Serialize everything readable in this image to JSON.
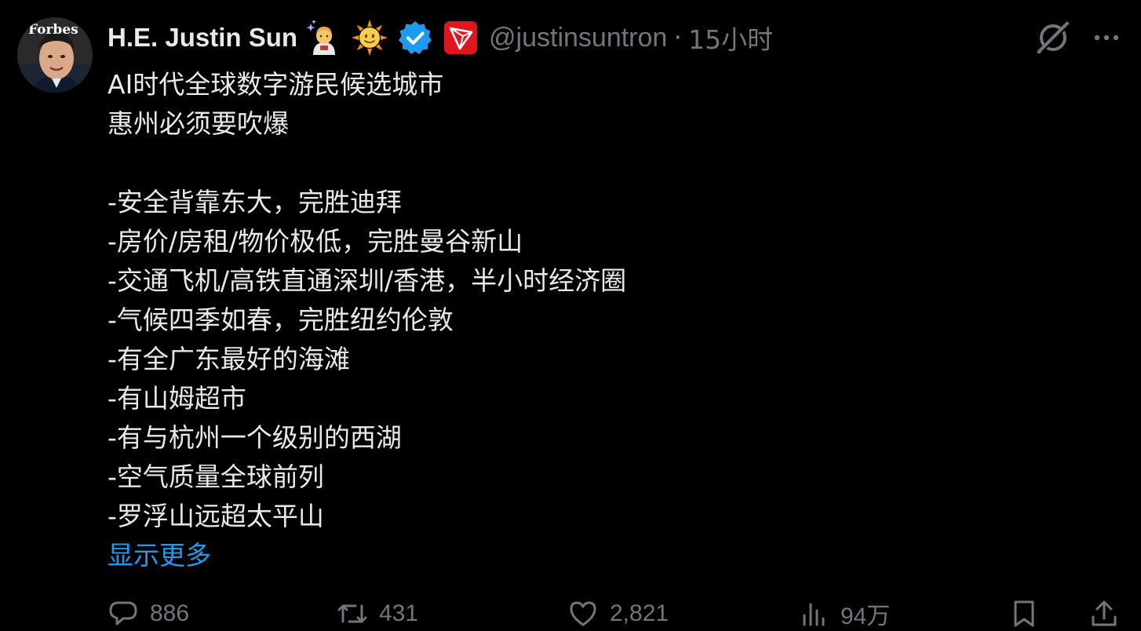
{
  "tweet": {
    "author": {
      "display_name": "H.E. Justin Sun",
      "handle": "@justinsuntron",
      "avatar_caption": "Forbes",
      "badges": [
        "astronaut-emoji",
        "sun-emoji",
        "verified-badge",
        "tron-logo"
      ]
    },
    "separator": "·",
    "time": "15小时",
    "lines": [
      "AI时代全球数字游民候选城市",
      "惠州必须要吹爆",
      "",
      "-安全背靠东大，完胜迪拜",
      "-房价/房租/物价极低，完胜曼谷新山",
      "-交通飞机/高铁直通深圳/香港，半小时经济圈",
      "-气候四季如春，完胜纽约伦敦",
      "-有全广东最好的海滩",
      "-有山姆超市",
      "-有与杭州一个级别的西湖",
      "-空气质量全球前列",
      "-罗浮山远超太平山"
    ],
    "show_more": "显示更多",
    "actions": {
      "replies": "886",
      "reposts": "431",
      "likes": "2,821",
      "views": "94万"
    }
  },
  "colors": {
    "background": "#000000",
    "text": "#e7e9ea",
    "secondary": "#71767b",
    "link": "#1d9bf0",
    "verified": "#1d9bf0",
    "tron": "#e0161f"
  },
  "icons": {
    "grok": "grok-icon",
    "more": "more-icon",
    "reply": "reply-icon",
    "repost": "repost-icon",
    "like": "like-icon",
    "views": "views-icon",
    "bookmark": "bookmark-icon",
    "share": "share-icon"
  }
}
